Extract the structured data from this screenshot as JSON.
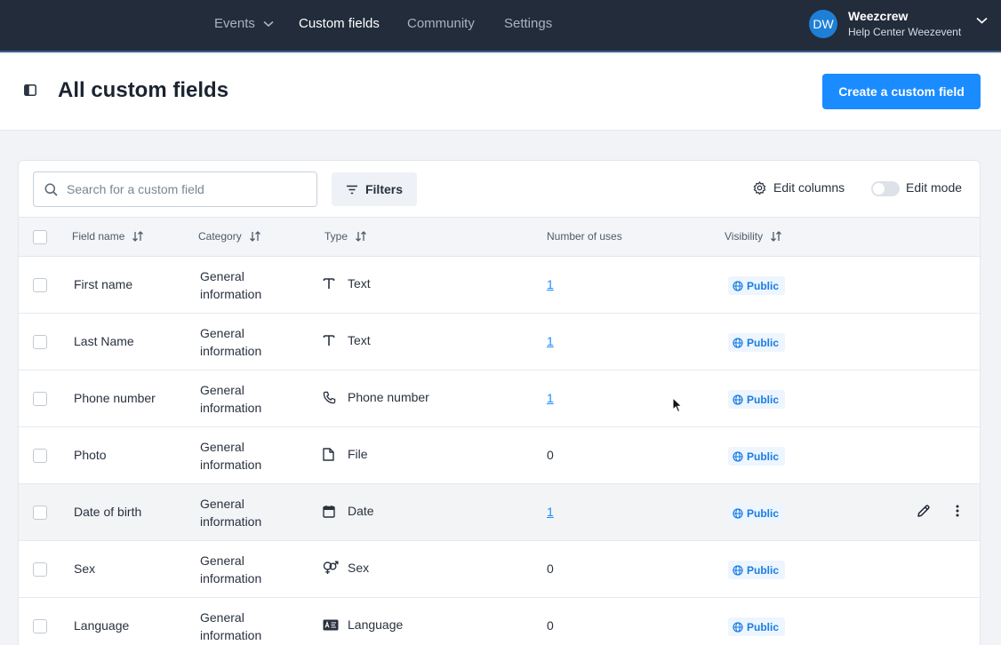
{
  "nav": {
    "items": [
      {
        "label": "Events"
      },
      {
        "label": "Custom fields"
      },
      {
        "label": "Community"
      },
      {
        "label": "Settings"
      }
    ],
    "user": {
      "initials": "DW",
      "name": "Weezcrew",
      "subtitle": "Help Center Weezevent"
    }
  },
  "header": {
    "title": "All custom fields",
    "create_label": "Create a custom field"
  },
  "toolbar": {
    "search_placeholder": "Search for a custom field",
    "filters_label": "Filters",
    "edit_columns_label": "Edit columns",
    "edit_mode_label": "Edit mode",
    "edit_mode_on": false
  },
  "table": {
    "columns": {
      "field_name": "Field name",
      "category": "Category",
      "type": "Type",
      "uses": "Number of uses",
      "visibility": "Visibility"
    },
    "rows": [
      {
        "name": "First name",
        "category_l1": "General",
        "category_l2": "information",
        "type_icon": "text-icon",
        "type": "Text",
        "uses": "1",
        "visibility": "Public"
      },
      {
        "name": "Last Name",
        "category_l1": "General",
        "category_l2": "information",
        "type_icon": "text-icon",
        "type": "Text",
        "uses": "1",
        "visibility": "Public"
      },
      {
        "name": "Phone number",
        "category_l1": "General",
        "category_l2": "information",
        "type_icon": "phone-icon",
        "type": "Phone number",
        "uses": "1",
        "visibility": "Public"
      },
      {
        "name": "Photo",
        "category_l1": "General",
        "category_l2": "information",
        "type_icon": "file-icon",
        "type": "File",
        "uses": "0",
        "visibility": "Public"
      },
      {
        "name": "Date of birth",
        "category_l1": "General",
        "category_l2": "information",
        "type_icon": "calendar-icon",
        "type": "Date",
        "uses": "1",
        "visibility": "Public"
      },
      {
        "name": "Sex",
        "category_l1": "General",
        "category_l2": "information",
        "type_icon": "gender-icon",
        "type": "Sex",
        "uses": "0",
        "visibility": "Public"
      },
      {
        "name": "Language",
        "category_l1": "General",
        "category_l2": "information",
        "type_icon": "language-icon",
        "type": "Language",
        "uses": "0",
        "visibility": "Public"
      }
    ]
  },
  "colors": {
    "accent": "#1a8cff",
    "topbar": "#222c3a",
    "badge_bg": "#edf5ff"
  }
}
